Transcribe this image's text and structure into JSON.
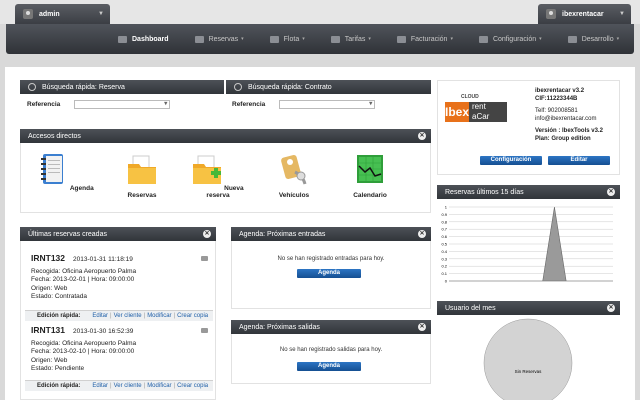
{
  "topbar": {
    "user": "admin",
    "company": "ibexrentacar"
  },
  "nav": [
    {
      "label": "Dashboard",
      "icon": "home-icon",
      "active": true
    },
    {
      "label": "Reservas",
      "icon": "car-icon",
      "caret": "▾"
    },
    {
      "label": "Flota",
      "icon": "car-fleet-icon",
      "caret": "▾"
    },
    {
      "label": "Tarifas",
      "icon": "tag-icon",
      "caret": "▾"
    },
    {
      "label": "Facturación",
      "icon": "invoice-icon",
      "caret": "▾"
    },
    {
      "label": "Configuración",
      "icon": "gear-icon",
      "caret": "▾"
    },
    {
      "label": "Desarrollo",
      "icon": "code-icon",
      "caret": "▾"
    }
  ],
  "search_reserva": {
    "title": "Búsqueda rápida: Reserva",
    "label": "Referencia"
  },
  "search_contrato": {
    "title": "Búsqueda rápida: Contrato",
    "label": "Referencia"
  },
  "accesos": {
    "title": "Accesos directos",
    "items": [
      {
        "label": "Agenda",
        "icon": "agenda-icon"
      },
      {
        "label": "Reservas",
        "icon": "folder-icon"
      },
      {
        "label": "Nueva reserva",
        "icon": "folder-add-icon"
      },
      {
        "label": "Vehículos",
        "icon": "car-key-icon"
      },
      {
        "label": "Calendario",
        "icon": "calendar-chart-icon"
      }
    ]
  },
  "ultimas": {
    "title": "Últimas reservas creadas",
    "quick_label": "Edición rápida:",
    "links": [
      "Editar",
      "Ver cliente",
      "Modificar",
      "Crear copia"
    ],
    "reservas": [
      {
        "code": "IRNT132",
        "created": "2013-01-31 11:18:19",
        "recogida": "Recogida: Oficina Aeropuerto Palma",
        "fecha": "Fecha: 2013-02-01 | Hora: 09:00:00",
        "origen": "Origen: Web",
        "estado": "Estado: Contratada"
      },
      {
        "code": "IRNT131",
        "created": "2013-01-30 16:52:39",
        "recogida": "Recogida: Oficina Aeropuerto Palma",
        "fecha": "Fecha: 2013-02-10 | Hora: 09:00:00",
        "origen": "Origen: Web",
        "estado": "Estado: Pendiente"
      }
    ]
  },
  "entradas": {
    "title": "Agenda: Próximas entradas",
    "message": "No se han registrado entradas para hoy.",
    "button": "Agenda"
  },
  "salidas": {
    "title": "Agenda: Próximas salidas",
    "message": "No se han registrado salidas para hoy.",
    "button": "Agenda"
  },
  "company": {
    "logo_small": "CLOUD",
    "logo_main": "Ibex",
    "logo_rent": "rent",
    "logo_car": "aCar",
    "version": "ibexrentacar v3.2",
    "cif": "CIF:11223344B",
    "tel": "Telf: 902008581",
    "email": "info@ibexrentacar.com",
    "version_line": "Versión : IbexTools v3.2",
    "plan": "Plan: Group edition",
    "btn_config": "Configuración",
    "btn_edit": "Editar"
  },
  "chart_reservas": {
    "title": "Reservas últimos 15 días"
  },
  "chart_data": [
    {
      "type": "area",
      "title": "Reservas últimos 15 días",
      "ylim": [
        0,
        1
      ],
      "yticks": [
        "0",
        "0.1",
        "0.2",
        "0.3",
        "0.4",
        "0.5",
        "0.6",
        "0.7",
        "0.8",
        "0.9",
        "1"
      ],
      "values": [
        0,
        0,
        0,
        0,
        0,
        0,
        0,
        0,
        0,
        1,
        0,
        0,
        0,
        0,
        0
      ],
      "grid": true,
      "color": "#9a9a9a"
    },
    {
      "type": "pie",
      "title": "Usuario del mes",
      "slices": [
        {
          "label": "Sin Reservas",
          "value": 1
        }
      ],
      "color": "#d3d3d3"
    }
  ],
  "usuario_mes": {
    "title": "Usuario del mes",
    "slice_label": "Sin Reservas"
  }
}
